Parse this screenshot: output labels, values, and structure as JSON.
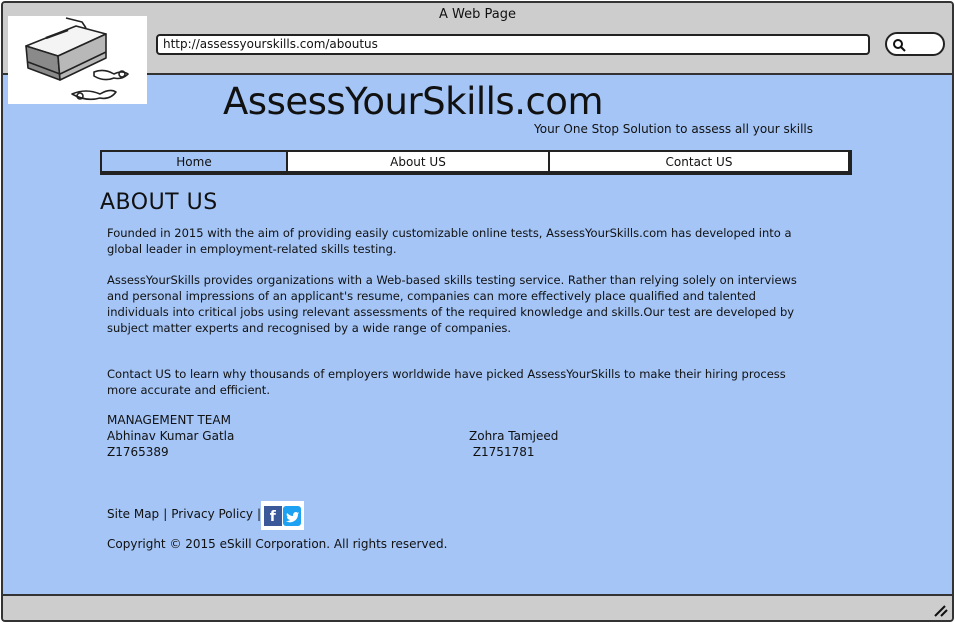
{
  "window": {
    "title": "A Web Page",
    "url": "http://assessyourskills.com/aboutus"
  },
  "site": {
    "title": "AssessYourSkills.com",
    "tagline": "Your One Stop Solution to assess all your skills"
  },
  "nav": {
    "items": [
      {
        "label": "Home",
        "active": true
      },
      {
        "label": "About US",
        "active": false
      },
      {
        "label": "Contact US",
        "active": false
      }
    ]
  },
  "main": {
    "heading": "ABOUT US",
    "paragraphs": [
      "Founded in 2015 with the aim of providing easily customizable online tests, AssessYourSkills.com has developed into a global leader in employment-related skills testing.",
      "AssessYourSkills provides organizations with a Web-based skills testing service. Rather than relying solely on interviews and personal impressions of an applicant's resume, companies can more effectively place qualified and talented individuals into critical jobs using relevant assessments of the required knowledge and skills.Our test are developed by subject matter experts and recognised by a wide range of companies.",
      "Contact US to learn why thousands of employers worldwide have picked AssessYourSkills to make their hiring process more accurate and efficient."
    ],
    "management": {
      "heading": "MANAGEMENT TEAM",
      "members": [
        {
          "name": "Abhinav Kumar Gatla",
          "id": "Z1765389"
        },
        {
          "name": "Zohra Tamjeed",
          "id": " Z1751781"
        }
      ]
    }
  },
  "footer": {
    "site_map": "Site Map",
    "separator": "|",
    "privacy": "Privacy Policy",
    "copyright": "Copyright © 2015 eSkill Corporation. All rights reserved.",
    "social_icons": [
      "facebook-icon",
      "twitter-icon"
    ]
  },
  "colors": {
    "page_bg": "#a4c5f6",
    "chrome_bg": "#cdcdcd",
    "nav_active": "#a4c5f6"
  }
}
